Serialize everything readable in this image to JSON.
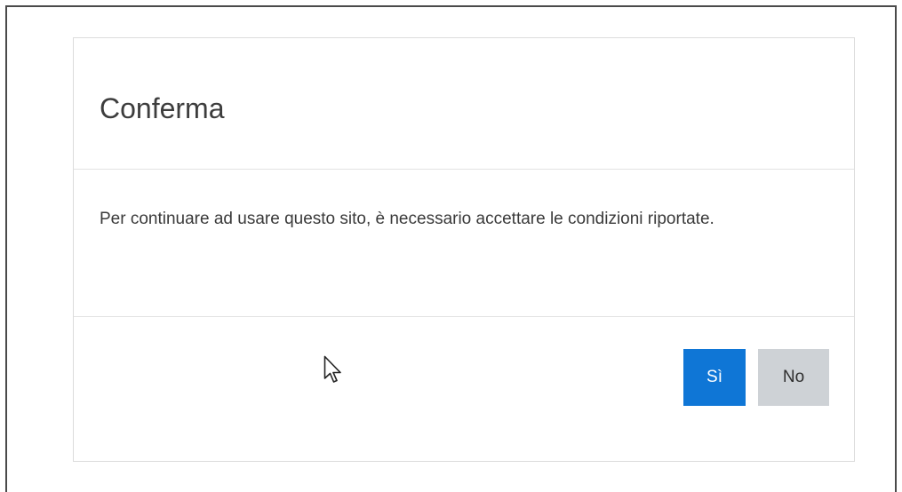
{
  "dialog": {
    "title": "Conferma",
    "message": "Per continuare ad usare questo sito, è necessario accettare le condizioni riportate.",
    "yes_label": "Sì",
    "no_label": "No"
  },
  "colors": {
    "primary_button": "#0f76d6",
    "secondary_button": "#ced2d6"
  },
  "icons": {
    "cursor": "mouse-pointer-icon"
  }
}
